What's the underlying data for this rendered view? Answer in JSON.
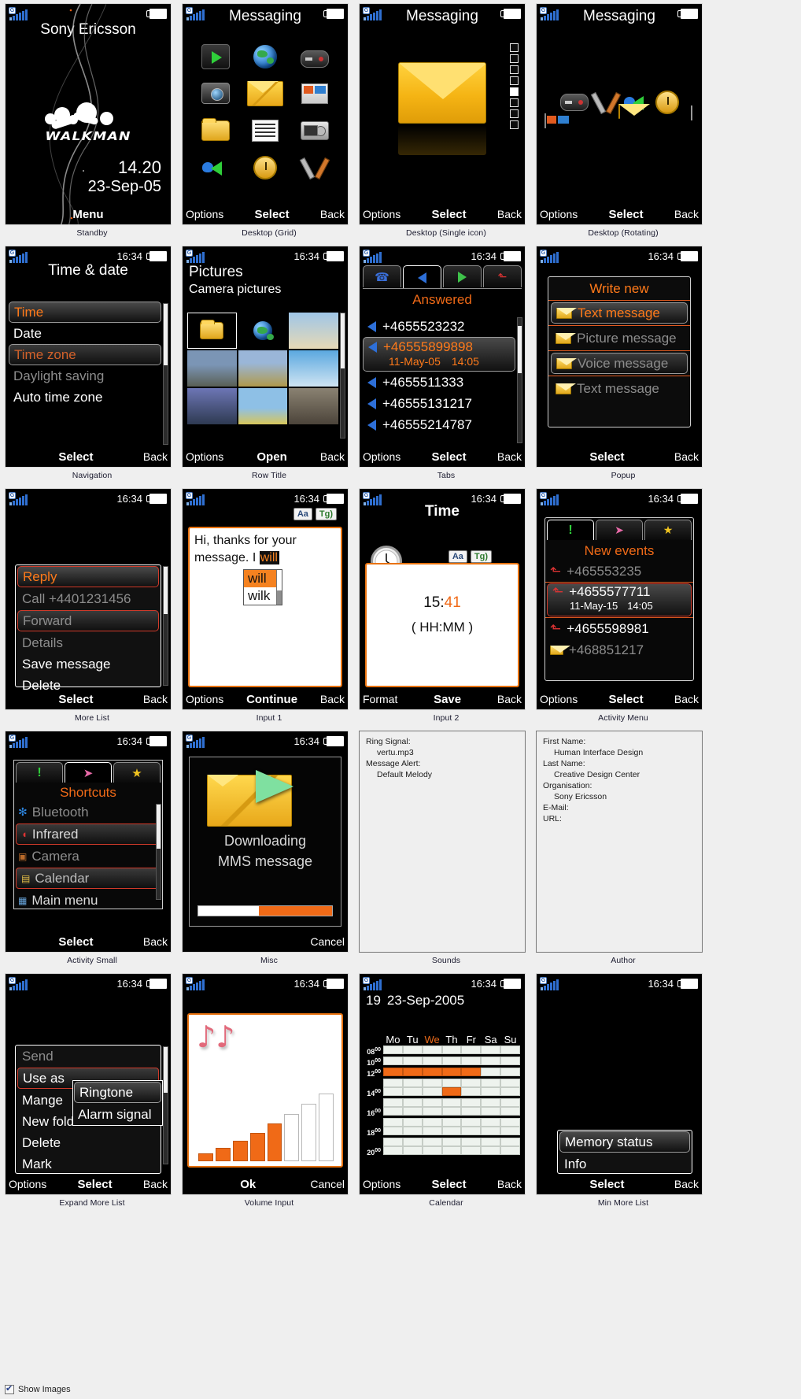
{
  "status": {
    "time_standby": "14.20",
    "time": "16:34",
    "signal_icon": "signal-bars-icon",
    "battery_icon": "battery-icon",
    "operator_icon": "operator-g-icon"
  },
  "footer": {
    "checkbox_label": "Show Images",
    "checked": true
  },
  "colors": {
    "accent": "#f06a17",
    "highlight_text": "#ff7a1a",
    "selected_bg": "#3a3a3a",
    "dim_text": "#8d8d8d"
  },
  "cells": [
    {
      "caption": "Standby",
      "brand": "Sony Ericsson",
      "logo_text": "WALKMAN",
      "time": "14.20",
      "date": "23-Sep-05",
      "softkeys": {
        "left": "",
        "center": "Menu",
        "right": ""
      }
    },
    {
      "caption": "Desktop (Grid)",
      "title": "Messaging",
      "icons": [
        "media-play-icon",
        "globe-icon",
        "gamepad-icon",
        "camera-icon",
        "envelope-icon",
        "windows-media-icon",
        "folder-icon",
        "list-icon",
        "radio-icon",
        "phone-green-icon",
        "alarm-icon",
        "tools-icon"
      ],
      "softkeys": {
        "left": "Options",
        "center": "Select",
        "right": "Back"
      }
    },
    {
      "caption": "Desktop (Single icon)",
      "title": "Messaging",
      "icon": "big-envelope-icon",
      "pager_total": 8,
      "pager_active": 5,
      "softkeys": {
        "left": "Options",
        "center": "Select",
        "right": "Back"
      }
    },
    {
      "caption": "Desktop (Rotating)",
      "title": "Messaging",
      "icons": [
        "gamepad-icon",
        "tools-icon",
        "phone-green-icon",
        "alarm-icon",
        "contact-icon",
        "envelope-icon",
        "list-icon"
      ],
      "softkeys": {
        "left": "Options",
        "center": "Select",
        "right": "Back"
      }
    },
    {
      "caption": "Navigation",
      "title": "Time & date",
      "items": [
        {
          "label": "Time",
          "state": "selected"
        },
        {
          "label": "Date",
          "state": "normal"
        },
        {
          "label": "Time zone",
          "state": "selected2"
        },
        {
          "label": "Daylight saving",
          "state": "dim"
        },
        {
          "label": "Auto time zone",
          "state": "normal"
        }
      ],
      "softkeys": {
        "left": "",
        "center": "Select",
        "right": "Back"
      }
    },
    {
      "caption": "Row Title",
      "title": "Pictures",
      "subtitle": "Camera pictures",
      "thumbs": 12,
      "softkeys": {
        "left": "Options",
        "center": "Open",
        "right": "Back"
      }
    },
    {
      "caption": "Tabs",
      "tabs": [
        "phone-icon",
        "arrow-left-blue-icon",
        "arrow-right-green-icon",
        "arrow-up-red-icon"
      ],
      "active_tab": 1,
      "list_title": "Answered",
      "items": [
        {
          "label": "+4655523232",
          "state": "normal",
          "icon": "arrow-left-blue-icon"
        },
        {
          "label": "+46555899898",
          "state": "selected",
          "icon": "arrow-left-blue-icon",
          "sub_date": "11-May-05",
          "sub_time": "14:05"
        },
        {
          "label": "+4655511333",
          "state": "normal",
          "icon": "arrow-left-blue-icon"
        },
        {
          "label": "+46555131217",
          "state": "normal",
          "icon": "arrow-left-blue-icon"
        },
        {
          "label": "+46555214787",
          "state": "normal",
          "icon": "arrow-left-blue-icon"
        }
      ],
      "softkeys": {
        "left": "Options",
        "center": "Select",
        "right": "Back"
      }
    },
    {
      "caption": "Popup",
      "popup_title": "Write new",
      "items": [
        {
          "label": "Text message",
          "state": "selected",
          "icon": "envelope-icon"
        },
        {
          "label": "Picture message",
          "state": "dim",
          "icon": "envelope-picture-icon"
        },
        {
          "label": "Voice message",
          "state": "selected2",
          "icon": "envelope-voice-icon"
        },
        {
          "label": "Text message",
          "state": "dim",
          "icon": "envelope-icon"
        }
      ],
      "softkeys": {
        "left": "",
        "center": "Select",
        "right": "Back"
      }
    },
    {
      "caption": "More List",
      "items": [
        {
          "label": "Reply",
          "state": "selected"
        },
        {
          "label": "Call +4401231456",
          "state": "dim"
        },
        {
          "label": "Forward",
          "state": "selected2"
        },
        {
          "label": "Details",
          "state": "dim"
        },
        {
          "label": "Save message",
          "state": "normal"
        },
        {
          "label": "Delete",
          "state": "normal"
        }
      ],
      "softkeys": {
        "left": "",
        "center": "Select",
        "right": "Back"
      }
    },
    {
      "caption": "Input 1",
      "badges": [
        "Aa",
        "Tg)"
      ],
      "text": "Hi, thanks for your message. I ",
      "composing_word": "will",
      "suggestions": [
        "will",
        "wilk"
      ],
      "softkeys": {
        "left": "Options",
        "center": "Continue",
        "right": "Back"
      }
    },
    {
      "caption": "Input 2",
      "title": "Time",
      "badges": [
        "Aa",
        "Tg)"
      ],
      "value_hour": "15:",
      "value_min": "41",
      "hint": "( HH:MM )",
      "icon": "clock-icon",
      "softkeys": {
        "left": "Format",
        "center": "Save",
        "right": "Back"
      }
    },
    {
      "caption": "Activity Menu",
      "tabs": [
        "exclamation-icon",
        "arrow-pink-icon",
        "star-icon"
      ],
      "active_tab": 0,
      "list_title": "New events",
      "items": [
        {
          "label": "+465553235",
          "state": "dim",
          "icon": "missed-call-icon"
        },
        {
          "label": "+4655577711",
          "state": "selected",
          "icon": "missed-call-icon",
          "sub_date": "11-May-15",
          "sub_time": "14:05"
        },
        {
          "label": "+4655598981",
          "state": "normal",
          "icon": "missed-call-icon"
        },
        {
          "label": "+468851217",
          "state": "dim",
          "icon": "envelope-icon"
        }
      ],
      "softkeys": {
        "left": "Options",
        "center": "Select",
        "right": "Back"
      }
    },
    {
      "caption": "Activity Small",
      "tabs": [
        "exclamation-icon",
        "arrow-pink-icon",
        "star-icon"
      ],
      "active_tab": 1,
      "list_title": "Shortcuts",
      "items": [
        {
          "label": "Bluetooth",
          "state": "dim",
          "icon": "bluetooth-icon"
        },
        {
          "label": "Infrared",
          "state": "selected-red",
          "icon": "infrared-icon"
        },
        {
          "label": "Camera",
          "state": "dim",
          "icon": "camera-icon"
        },
        {
          "label": "Calendar",
          "state": "selected-red",
          "icon": "calendar-icon"
        },
        {
          "label": "Main menu",
          "state": "normal",
          "icon": "main-menu-icon"
        }
      ],
      "softkeys": {
        "left": "",
        "center": "Select",
        "right": "Back"
      }
    },
    {
      "caption": "Misc",
      "icon": "envelope-send-icon",
      "line1": "Downloading",
      "line2": "MMS message",
      "progress_percent": 45,
      "softkeys": {
        "left": "",
        "center": "",
        "right": "Cancel"
      }
    },
    {
      "caption": "Sounds",
      "type": "document",
      "lines": [
        {
          "text": "Ring Signal:",
          "indent": false
        },
        {
          "text": "vertu.mp3",
          "indent": true
        },
        {
          "text": "Message Alert:",
          "indent": false
        },
        {
          "text": "Default Melody",
          "indent": true
        }
      ]
    },
    {
      "caption": "Author",
      "type": "document",
      "lines": [
        {
          "text": "First Name:",
          "indent": false
        },
        {
          "text": "Human Interface Design",
          "indent": true
        },
        {
          "text": "Last Name:",
          "indent": false
        },
        {
          "text": "Creative Design Center",
          "indent": true
        },
        {
          "text": "Organisation:",
          "indent": false
        },
        {
          "text": "Sony Ericsson",
          "indent": true
        },
        {
          "text": "E-Mail:",
          "indent": false
        },
        {
          "text": "",
          "indent": false
        },
        {
          "text": "URL:",
          "indent": false
        }
      ]
    },
    {
      "caption": "Expand More List",
      "items": [
        {
          "label": "Send",
          "state": "dim"
        },
        {
          "label": "Use as",
          "state": "selected-red"
        },
        {
          "label": "Mange",
          "state": "normal"
        },
        {
          "label": "New folder",
          "state": "normal"
        },
        {
          "label": "Delete",
          "state": "normal"
        },
        {
          "label": "Mark",
          "state": "normal"
        }
      ],
      "submenu": [
        {
          "label": "Ringtone",
          "state": "selected"
        },
        {
          "label": "Alarm signal",
          "state": "normal"
        }
      ],
      "softkeys": {
        "left": "Options",
        "center": "Select",
        "right": "Back"
      }
    },
    {
      "caption": "Volume Input",
      "icon": "music-notes-icon",
      "softkeys": {
        "left": "",
        "center": "Ok",
        "right": "Cancel"
      }
    },
    {
      "caption": "Calendar",
      "week_number": "19",
      "date": "23-Sep-2005",
      "day_headers": [
        "Mo",
        "Tu",
        "We",
        "Th",
        "Fr",
        "Sa",
        "Su"
      ],
      "today_index": 2,
      "hour_labels": [
        "08",
        "10",
        "12",
        "14",
        "16",
        "18",
        "20"
      ],
      "hour_suffix": "00",
      "softkeys": {
        "left": "Options",
        "center": "Select",
        "right": "Back"
      }
    },
    {
      "caption": "Min More List",
      "items": [
        {
          "label": "Memory status",
          "state": "selected"
        },
        {
          "label": "Info",
          "state": "normal"
        }
      ],
      "softkeys": {
        "left": "",
        "center": "Select",
        "right": "Back"
      }
    }
  ],
  "chart_data": {
    "type": "bar",
    "title": "Volume Input",
    "categories": [
      "1",
      "2",
      "3",
      "4",
      "5",
      "6",
      "7",
      "8"
    ],
    "values": [
      1,
      2,
      3,
      4,
      5,
      6,
      7,
      8
    ],
    "filled_count": 5,
    "ylim": [
      0,
      8
    ],
    "xlabel": "",
    "ylabel": ""
  }
}
